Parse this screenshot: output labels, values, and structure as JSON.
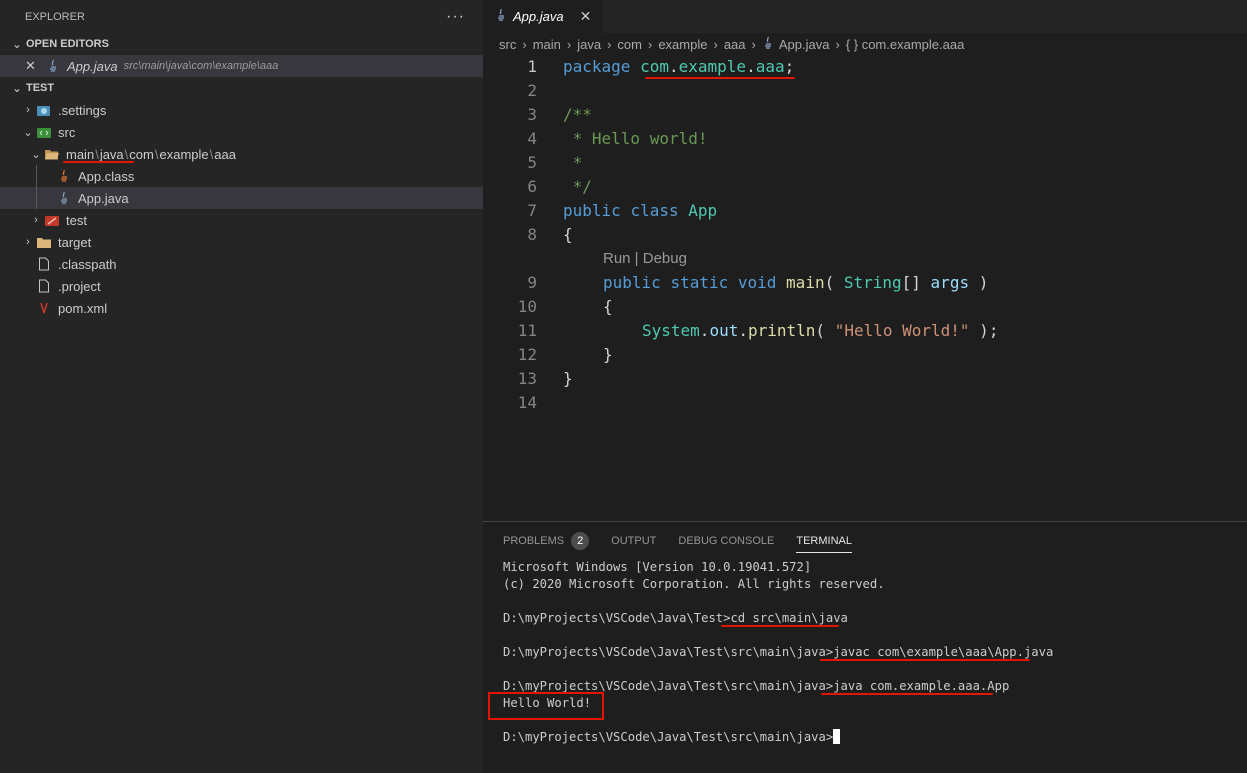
{
  "explorer": {
    "title": "EXPLORER",
    "more": "···",
    "open_editors": {
      "label": "OPEN EDITORS",
      "items": [
        {
          "close": "✕",
          "name": "App.java",
          "path": "src\\main\\java\\com\\example\\aaa"
        }
      ]
    },
    "project": {
      "label": "TEST",
      "items": {
        "settings": ".settings",
        "src": "src",
        "main_segments": [
          "main",
          "java",
          "com",
          "example",
          "aaa"
        ],
        "path_sep": "\\",
        "app_class": "App.class",
        "app_java": "App.java",
        "test": "test",
        "target": "target",
        "classpath": ".classpath",
        "dotproject": ".project",
        "pom": "pom.xml"
      }
    }
  },
  "editor": {
    "tab": {
      "name": "App.java",
      "close": "✕"
    },
    "breadcrumb": [
      "src",
      "main",
      "java",
      "com",
      "example",
      "aaa",
      "App.java",
      "{ } com.example.aaa"
    ],
    "codelens": "Run | Debug",
    "line_numbers": [
      "1",
      "2",
      "3",
      "4",
      "5",
      "6",
      "7",
      "8",
      "9",
      "10",
      "11",
      "12",
      "13",
      "14"
    ],
    "code": {
      "l1": {
        "kw": "package",
        "pkg": [
          "com",
          ".",
          "example",
          ".",
          "aaa"
        ],
        "semi": ";"
      },
      "l3": "/**",
      "l4": " * Hello world!",
      "l5": " *",
      "l6": " */",
      "l7": {
        "kw1": "public",
        "kw2": "class",
        "name": "App"
      },
      "l8": "{",
      "l9": {
        "kw1": "public",
        "kw2": "static",
        "kw3": "void",
        "fn": "main",
        "open": "( ",
        "type": "String",
        "arr": "[] ",
        "arg": "args",
        "close": " )"
      },
      "l10": "{",
      "l11": {
        "obj": "System",
        "dot1": ".",
        "field": "out",
        "dot2": ".",
        "fn": "println",
        "open": "( ",
        "str": "\"Hello World!\"",
        "close": " );"
      },
      "l12": "}",
      "l13": "}"
    }
  },
  "panel": {
    "tabs": {
      "problems": "PROBLEMS",
      "problems_count": "2",
      "output": "OUTPUT",
      "debug": "DEBUG CONSOLE",
      "terminal": "TERMINAL"
    },
    "terminal": {
      "l1": "Microsoft Windows [Version 10.0.19041.572]",
      "l2": "(c) 2020 Microsoft Corporation. All rights reserved.",
      "p1": "D:\\myProjects\\VSCode\\Java\\Test>",
      "c1": "cd src\\main\\java",
      "p2": "D:\\myProjects\\VSCode\\Java\\Test\\src\\main\\java>",
      "c2": "javac com\\example\\aaa\\App.java",
      "p3": "D:\\myProjects\\VSCode\\Java\\Test\\src\\main\\java>",
      "c3": "java com.example.aaa.App",
      "out": "Hello World!",
      "p4": "D:\\myProjects\\VSCode\\Java\\Test\\src\\main\\java>"
    }
  },
  "colors": {
    "annotation_red": "#e51400",
    "keyword": "#569cd6",
    "type": "#4ec9b0",
    "comment": "#6a9955",
    "string": "#ce9178"
  }
}
